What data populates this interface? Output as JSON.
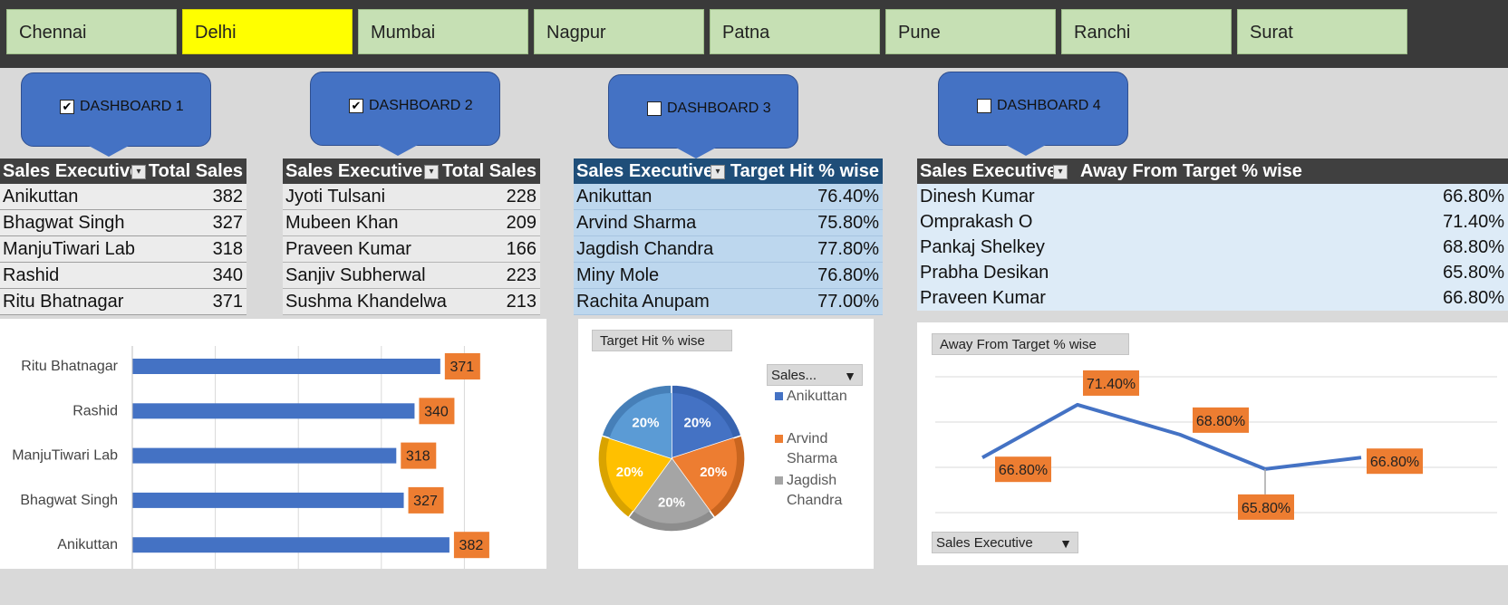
{
  "slicer": {
    "cities": [
      "Chennai",
      "Delhi",
      "Mumbai",
      "Nagpur",
      "Patna",
      "Pune",
      "Ranchi",
      "Surat"
    ],
    "selected": "Delhi",
    "selected_color": "#ffff00",
    "unselected_color": "#c6e0b4"
  },
  "callouts": [
    {
      "label": "DASHBOARD 1",
      "checked": true
    },
    {
      "label": "DASHBOARD 2",
      "checked": true
    },
    {
      "label": "DASHBOARD 3",
      "checked": false
    },
    {
      "label": "DASHBOARD 4",
      "checked": false
    }
  ],
  "tables": [
    {
      "col1": "Sales Executive",
      "col2": "Total Sales",
      "rows": [
        [
          "Anikuttan",
          "382"
        ],
        [
          "Bhagwat Singh",
          "327"
        ],
        [
          "ManjuTiwari Lab",
          "318"
        ],
        [
          "Rashid",
          "340"
        ],
        [
          "Ritu Bhatnagar",
          "371"
        ]
      ]
    },
    {
      "col1": "Sales Executive",
      "col2": "Total Sales",
      "rows": [
        [
          "Jyoti Tulsani",
          "228"
        ],
        [
          "Mubeen Khan",
          "209"
        ],
        [
          "Praveen Kumar",
          "166"
        ],
        [
          "Sanjiv Subherwal",
          "223"
        ],
        [
          "Sushma Khandelwa",
          "213"
        ]
      ]
    },
    {
      "col1": "Sales Executive",
      "col2": "Target Hit % wise",
      "rows": [
        [
          "Anikuttan",
          "76.40%"
        ],
        [
          "Arvind Sharma",
          "75.80%"
        ],
        [
          "Jagdish Chandra",
          "77.80%"
        ],
        [
          "Miny Mole",
          "76.80%"
        ],
        [
          "Rachita Anupam",
          "77.00%"
        ]
      ]
    },
    {
      "col1": "Sales Executive",
      "col2": "Away From Target % wise",
      "rows": [
        [
          "Dinesh Kumar",
          "66.80%"
        ],
        [
          "Omprakash O",
          "71.40%"
        ],
        [
          "Pankaj Shelkey",
          "68.80%"
        ],
        [
          "Prabha Desikan",
          "65.80%"
        ],
        [
          "Praveen Kumar",
          "66.80%"
        ]
      ]
    }
  ],
  "pie_chip": "Target Hit % wise",
  "pie_legend_chip": "Sales...",
  "line_chip": "Away From Target % wise",
  "line_filter_chip": "Sales Executive",
  "chart_data": [
    {
      "type": "bar",
      "categories": [
        "Ritu Bhatnagar",
        "Rashid",
        "ManjuTiwari Lab",
        "Bhagwat Singh",
        "Anikuttan"
      ],
      "values": [
        371,
        340,
        318,
        327,
        382
      ],
      "xlim": [
        0,
        400
      ],
      "grid": true,
      "bar_color": "#4472c4",
      "label_color": "#ed7d31"
    },
    {
      "type": "pie",
      "title": "Target Hit % wise",
      "labels": [
        "Anikuttan",
        "Arvind Sharma",
        "Jagdish Chandra",
        "Miny Mole",
        "Rachita Anupam"
      ],
      "values": [
        20,
        20,
        20,
        20,
        20
      ],
      "display": [
        "20%",
        "20%",
        "20%",
        "20%",
        "20%"
      ],
      "colors": [
        "#4472c4",
        "#ed7d31",
        "#a5a5a5",
        "#ffc000",
        "#5b9bd5"
      ],
      "legend_visible": [
        "Anikuttan",
        "Arvind Sharma",
        "Jagdish Chandra"
      ],
      "legend_position": "right"
    },
    {
      "type": "line",
      "title": "Away From Target % wise",
      "categories": [
        "Dinesh Kumar",
        "Omprakash O",
        "Pankaj Shelkey",
        "Prabha Desikan",
        "Praveen Kumar"
      ],
      "values": [
        66.8,
        71.4,
        68.8,
        65.8,
        66.8
      ],
      "display": [
        "66.80%",
        "71.40%",
        "68.80%",
        "65.80%",
        "66.80%"
      ],
      "ylim": [
        62,
        74
      ],
      "line_color": "#4472c4",
      "label_color": "#ed7d31"
    }
  ]
}
